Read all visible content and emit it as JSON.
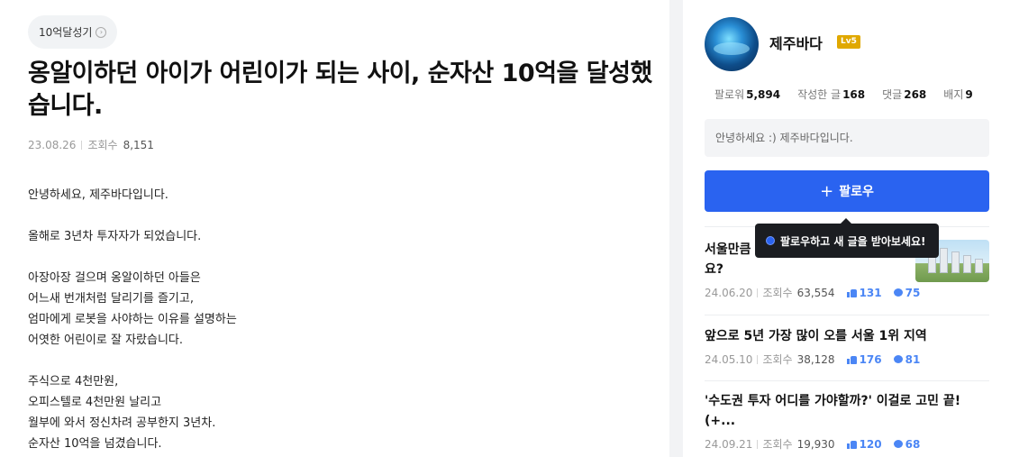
{
  "article": {
    "category": "10억달성기",
    "title": "옹알이하던 아이가 어린이가 되는 사이, 순자산 10억을 달성했습니다.",
    "date": "23.08.26",
    "views_label": "조회수",
    "views": "8,151",
    "paragraphs": [
      [
        "안녕하세요, 제주바다입니다."
      ],
      [
        "올해로 3년차 투자자가 되었습니다."
      ],
      [
        "아장아장 걸으며 옹알이하던 아들은",
        "어느새 번개처럼 달리기를 즐기고,",
        "엄마에게 로봇을 사야하는 이유를 설명하는",
        "어엿한 어린이로 잘 자랐습니다."
      ],
      [
        "주식으로 4천만원,",
        "오피스텔로 4천만원 날리고",
        "월부에 와서 정신차려 공부한지 3년차.",
        "순자산 10억을 넘겼습니다."
      ]
    ]
  },
  "profile": {
    "name": "제주바다",
    "level": "Lv5",
    "stats": [
      {
        "label": "팔로워",
        "value": "5,894"
      },
      {
        "label": "작성한 글",
        "value": "168"
      },
      {
        "label": "댓글",
        "value": "268"
      },
      {
        "label": "배지",
        "value": "9"
      }
    ],
    "greeting": "안녕하세요 :) 제주바다입니다.",
    "follow_label": "팔로우",
    "tooltip": "팔로우하고 새 글을 받아보세요!"
  },
  "posts": [
    {
      "title_line1": "서울만큼",
      "title_line2": "요?",
      "date": "24.06.20",
      "views_label": "조회수",
      "views": "63,554",
      "likes": "131",
      "comments": "75"
    },
    {
      "title_line1": "앞으로 5년 가장 많이 오를 서울 1위 지역",
      "title_line2": "",
      "date": "24.05.10",
      "views_label": "조회수",
      "views": "38,128",
      "likes": "176",
      "comments": "81"
    },
    {
      "title_line1": "'수도권 투자 어디를 가야할까?' 이걸로 고민 끝! (+...",
      "title_line2": "",
      "date": "24.09.21",
      "views_label": "조회수",
      "views": "19,930",
      "likes": "120",
      "comments": "68"
    }
  ],
  "colors": {
    "accent": "#2a63f0",
    "level_badge": "#e0a800",
    "stat_blue": "#4b86f5"
  }
}
